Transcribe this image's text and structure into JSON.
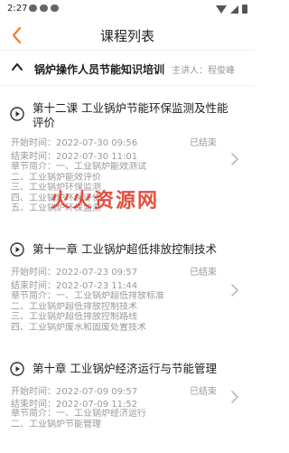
{
  "status_bar": {
    "time": "2:27"
  },
  "nav": {
    "title": "课程列表"
  },
  "course": {
    "name": "锅炉操作人员节能知识培训",
    "lecturer": "主讲人：程俊峰"
  },
  "watermark": "火火资源网",
  "lessons": [
    {
      "title": "第十二课 工业锅炉节能环保监测及性能评价",
      "start": "开始时间：2022-07-30 09:56",
      "end": "结束时间：2022-07-30 11:01",
      "status": "已结束",
      "summary": [
        "章节简介：一、工业锅炉能效测试",
        "二、工业锅炉能效评价",
        "三、工业锅炉环保监测",
        "四、工业锅炉环保评价",
        "五、工业锅炉环保监测"
      ]
    },
    {
      "title": "第十一章 工业锅炉超低排放控制技术",
      "start": "开始时间：2022-07-23 09:57",
      "end": "结束时间：2022-07-23 11:44",
      "status": "已结束",
      "summary": [
        "章节简介：一、工业锅炉超低排放标准",
        "二、工业锅炉超低排放控制技术",
        "三、工业锅炉超低排放控制路线",
        "四、工业锅炉废水和固废处置技术"
      ]
    },
    {
      "title": "第十章 工业锅炉经济运行与节能管理",
      "start": "开始时间：2022-07-09 09:57",
      "end": "结束时间：2022-07-09 11:52",
      "status": "已结束",
      "summary": [
        "章节简介：一、工业锅炉经济运行",
        "二、工业锅炉节能管理"
      ]
    }
  ]
}
